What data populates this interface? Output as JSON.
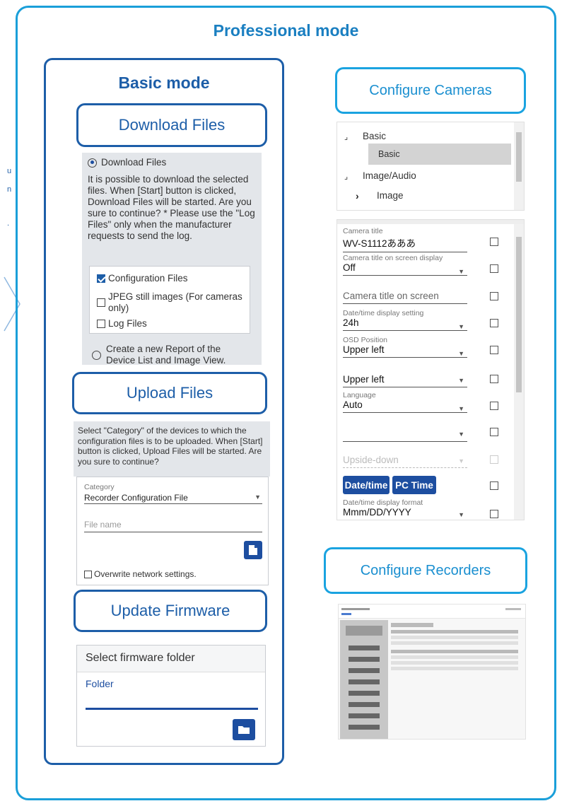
{
  "left_fragments": {
    "a": "u",
    "b": "n",
    "c": "."
  },
  "pro_title": "Professional mode",
  "basic_title": "Basic mode",
  "download": {
    "button": "Download Files",
    "radio1": "Download Files",
    "description": "It is possible to download the selected files. When [Start] button is clicked, Download Files will be started. Are you sure to continue? * Please use the \"Log Files\" only when the manufacturer requests to send the log.",
    "options": [
      {
        "label": "Configuration Files",
        "checked": true
      },
      {
        "label": "JPEG still images (For cameras only)",
        "checked": false
      },
      {
        "label": "Log Files",
        "checked": false
      }
    ],
    "radio2": "Create a new Report of the Device List and Image View."
  },
  "upload": {
    "button": "Upload Files",
    "description": "Select \"Category\" of the devices to which the configuration files is to be uploaded. When [Start] button is clicked, Upload Files will be started. Are you sure to continue?",
    "category_label": "Category",
    "category_value": "Recorder Configuration File",
    "file_placeholder": "File name",
    "overwrite": "Overwrite network settings."
  },
  "firmware": {
    "button": "Update Firmware",
    "select_label": "Select firmware folder",
    "folder_label": "Folder"
  },
  "cameras": {
    "button": "Configure Cameras",
    "tree": [
      {
        "label": "Basic",
        "marker": "⌟",
        "selected": false
      },
      {
        "label": "Basic",
        "marker": "",
        "selected": true
      },
      {
        "label": "Image/Audio",
        "marker": "⌟",
        "selected": false
      },
      {
        "label": "Image",
        "marker": "›",
        "selected": false
      }
    ],
    "fields": [
      {
        "label": "Camera title",
        "value": "WV-S1112あああ",
        "dropdown": false
      },
      {
        "label": "Camera title on screen display",
        "value": "Off",
        "dropdown": true
      },
      {
        "label": "",
        "value": "Camera title on screen",
        "dropdown": false,
        "placeholder": true
      },
      {
        "label": "Date/time display setting",
        "value": "24h",
        "dropdown": true
      },
      {
        "label": "OSD Position",
        "value": "Upper left",
        "dropdown": true
      },
      {
        "label": "",
        "value": "Upper left",
        "dropdown": true
      },
      {
        "label": "Language",
        "value": "Auto",
        "dropdown": true
      },
      {
        "label": "",
        "value": "",
        "dropdown": true
      },
      {
        "label": "",
        "value": "Upside-down",
        "dropdown": true,
        "disabled": true
      }
    ],
    "btn_datetime": "Date/time",
    "btn_pctime": "PC Time",
    "format_label": "Date/time display format",
    "format_value": "Mmm/DD/YYYY"
  },
  "recorders": {
    "button": "Configure Recorders"
  },
  "colors": {
    "outer": "#1a9fd9",
    "basic": "#1d5ea8",
    "panel": "#e3e6ea",
    "button_fill": "#1d4ea0"
  }
}
